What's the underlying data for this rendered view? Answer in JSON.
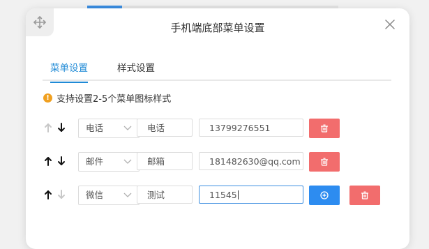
{
  "dialog": {
    "title": "手机端底部菜单设置"
  },
  "tabs": [
    {
      "label": "菜单设置",
      "active": true
    },
    {
      "label": "样式设置",
      "active": false
    }
  ],
  "tip": {
    "text": "支持设置2-5个菜单图标样式",
    "icon": "warning-icon"
  },
  "rows": [
    {
      "up_enabled": false,
      "down_enabled": true,
      "type": "电话",
      "name": "电话",
      "value": "13799276551",
      "show_add": false
    },
    {
      "up_enabled": true,
      "down_enabled": true,
      "type": "邮件",
      "name": "邮箱",
      "value": "181482630@qq.com",
      "show_add": false
    },
    {
      "up_enabled": true,
      "down_enabled": false,
      "type": "微信",
      "name": "测试",
      "value": "11545",
      "show_add": true,
      "focused": true
    }
  ],
  "colors": {
    "accent": "#1f8ad6",
    "delete": "#f26d6d",
    "add": "#2d8cf0",
    "warning": "#f0a020"
  }
}
